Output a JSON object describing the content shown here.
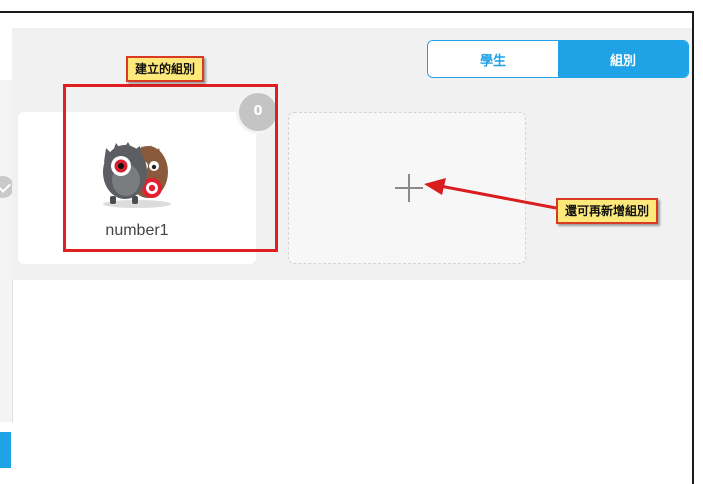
{
  "toggle": {
    "students_label": "學生",
    "groups_label": "組別"
  },
  "group_card": {
    "name": "number1",
    "member_count": "0"
  },
  "annotations": {
    "created_group_label": "建立的組別",
    "add_more_label": "還可再新增組別"
  },
  "colors": {
    "accent": "#1fa3e6",
    "annotation_red": "#e02020",
    "callout_yellow": "#ffe97a"
  }
}
